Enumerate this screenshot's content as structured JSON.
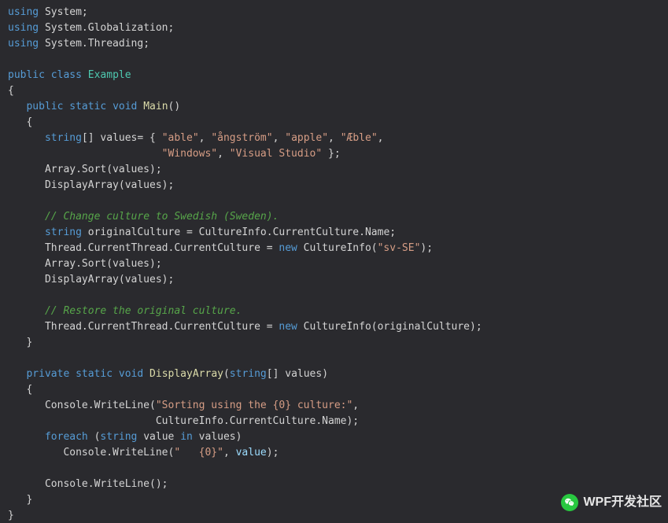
{
  "watermark": {
    "text": "WPF开发社区"
  },
  "code": {
    "lines": [
      [
        [
          "kw",
          "using"
        ],
        [
          "plain",
          " System;"
        ]
      ],
      [
        [
          "kw",
          "using"
        ],
        [
          "plain",
          " System.Globalization;"
        ]
      ],
      [
        [
          "kw",
          "using"
        ],
        [
          "plain",
          " System.Threading;"
        ]
      ],
      [],
      [
        [
          "kw",
          "public"
        ],
        [
          "plain",
          " "
        ],
        [
          "kw",
          "class"
        ],
        [
          "plain",
          " "
        ],
        [
          "type",
          "Example"
        ]
      ],
      [
        [
          "plain",
          "{"
        ]
      ],
      [
        [
          "plain",
          "   "
        ],
        [
          "kw",
          "public"
        ],
        [
          "plain",
          " "
        ],
        [
          "kw",
          "static"
        ],
        [
          "plain",
          " "
        ],
        [
          "kw",
          "void"
        ],
        [
          "plain",
          " "
        ],
        [
          "fn",
          "Main"
        ],
        [
          "plain",
          "()"
        ]
      ],
      [
        [
          "plain",
          "   {"
        ]
      ],
      [
        [
          "plain",
          "      "
        ],
        [
          "kw",
          "string"
        ],
        [
          "plain",
          "[] values= { "
        ],
        [
          "str",
          "\"able\""
        ],
        [
          "plain",
          ", "
        ],
        [
          "str",
          "\"ångström\""
        ],
        [
          "plain",
          ", "
        ],
        [
          "str",
          "\"apple\""
        ],
        [
          "plain",
          ", "
        ],
        [
          "str",
          "\"Æble\""
        ],
        [
          "plain",
          ","
        ]
      ],
      [
        [
          "plain",
          "                         "
        ],
        [
          "str",
          "\"Windows\""
        ],
        [
          "plain",
          ", "
        ],
        [
          "str",
          "\"Visual Studio\""
        ],
        [
          "plain",
          " };"
        ]
      ],
      [
        [
          "plain",
          "      Array.Sort(values);"
        ]
      ],
      [
        [
          "plain",
          "      DisplayArray(values);"
        ]
      ],
      [],
      [
        [
          "plain",
          "      "
        ],
        [
          "comment",
          "// Change culture to Swedish (Sweden)."
        ]
      ],
      [
        [
          "plain",
          "      "
        ],
        [
          "kw",
          "string"
        ],
        [
          "plain",
          " originalCulture = CultureInfo.CurrentCulture.Name;"
        ]
      ],
      [
        [
          "plain",
          "      Thread.CurrentThread.CurrentCulture = "
        ],
        [
          "kw",
          "new"
        ],
        [
          "plain",
          " CultureInfo("
        ],
        [
          "str",
          "\"sv-SE\""
        ],
        [
          "plain",
          ");"
        ]
      ],
      [
        [
          "plain",
          "      Array.Sort(values);"
        ]
      ],
      [
        [
          "plain",
          "      DisplayArray(values);"
        ]
      ],
      [],
      [
        [
          "plain",
          "      "
        ],
        [
          "comment",
          "// Restore the original culture."
        ]
      ],
      [
        [
          "plain",
          "      Thread.CurrentThread.CurrentCulture = "
        ],
        [
          "kw",
          "new"
        ],
        [
          "plain",
          " CultureInfo(originalCulture);"
        ]
      ],
      [
        [
          "plain",
          "   }"
        ]
      ],
      [],
      [
        [
          "plain",
          "   "
        ],
        [
          "kw",
          "private"
        ],
        [
          "plain",
          " "
        ],
        [
          "kw",
          "static"
        ],
        [
          "plain",
          " "
        ],
        [
          "kw",
          "void"
        ],
        [
          "plain",
          " "
        ],
        [
          "fn",
          "DisplayArray"
        ],
        [
          "plain",
          "("
        ],
        [
          "kw",
          "string"
        ],
        [
          "plain",
          "[] values)"
        ]
      ],
      [
        [
          "plain",
          "   {"
        ]
      ],
      [
        [
          "plain",
          "      Console.WriteLine("
        ],
        [
          "str",
          "\"Sorting using the {0} culture:\""
        ],
        [
          "plain",
          ","
        ]
      ],
      [
        [
          "plain",
          "                        CultureInfo.CurrentCulture.Name);"
        ]
      ],
      [
        [
          "plain",
          "      "
        ],
        [
          "kw",
          "foreach"
        ],
        [
          "plain",
          " ("
        ],
        [
          "kw",
          "string"
        ],
        [
          "plain",
          " value "
        ],
        [
          "kw",
          "in"
        ],
        [
          "plain",
          " values)"
        ]
      ],
      [
        [
          "plain",
          "         Console.WriteLine("
        ],
        [
          "str",
          "\"   {0}\""
        ],
        [
          "plain",
          ", "
        ],
        [
          "id",
          "value"
        ],
        [
          "plain",
          ");"
        ]
      ],
      [],
      [
        [
          "plain",
          "      Console.WriteLine();"
        ]
      ],
      [
        [
          "plain",
          "   }"
        ]
      ],
      [
        [
          "plain",
          "}"
        ]
      ]
    ]
  }
}
